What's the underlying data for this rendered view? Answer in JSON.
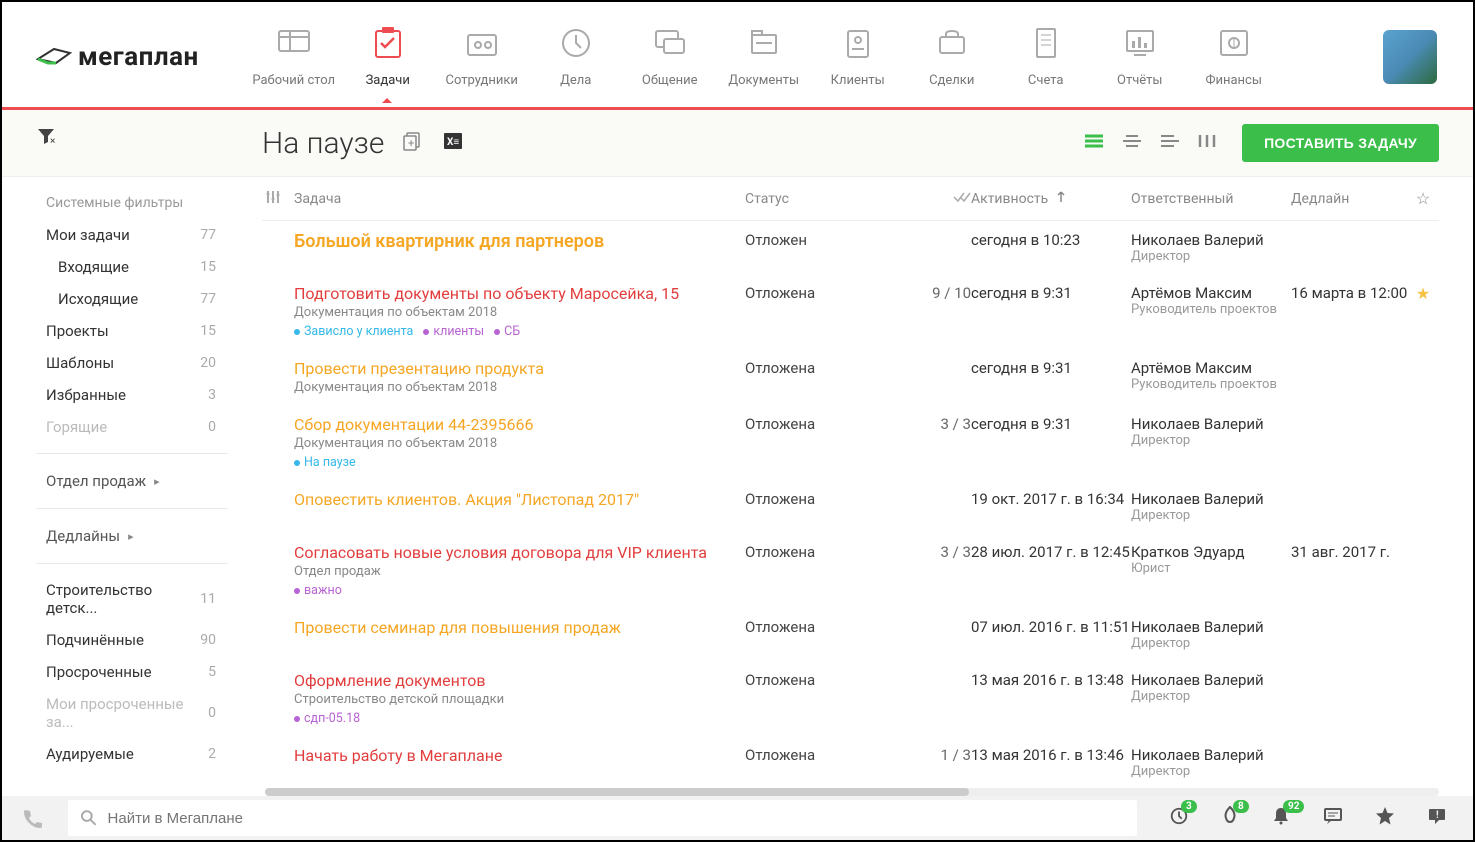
{
  "logo_text": "мегаплан",
  "nav": [
    {
      "label": "Рабочий стол",
      "icon": "desktop"
    },
    {
      "label": "Задачи",
      "icon": "tasks",
      "active": true
    },
    {
      "label": "Сотрудники",
      "icon": "staff"
    },
    {
      "label": "Дела",
      "icon": "time"
    },
    {
      "label": "Общение",
      "icon": "chat"
    },
    {
      "label": "Документы",
      "icon": "docs"
    },
    {
      "label": "Клиенты",
      "icon": "clients"
    },
    {
      "label": "Сделки",
      "icon": "deals"
    },
    {
      "label": "Счета",
      "icon": "invoices"
    },
    {
      "label": "Отчёты",
      "icon": "reports"
    },
    {
      "label": "Финансы",
      "icon": "finance"
    }
  ],
  "page": {
    "title": "На паузе",
    "primary_button": "ПОСТАВИТЬ ЗАДАЧУ"
  },
  "sidebar": {
    "filters_header": "Системные фильтры",
    "items": [
      {
        "label": "Мои задачи",
        "cnt": "77"
      },
      {
        "label": "Входящие",
        "cnt": "15",
        "sub": true
      },
      {
        "label": "Исходящие",
        "cnt": "77",
        "sub": true
      },
      {
        "label": "Проекты",
        "cnt": "15"
      },
      {
        "label": "Шаблоны",
        "cnt": "20"
      },
      {
        "label": "Избранные",
        "cnt": "3"
      },
      {
        "label": "Горящие",
        "cnt": "0",
        "muted": true
      }
    ],
    "group2": [
      {
        "label": "Отдел продаж",
        "arrow": true
      }
    ],
    "group3": [
      {
        "label": "Дедлайны",
        "arrow": true
      }
    ],
    "items2": [
      {
        "label": "Строительство детск...",
        "cnt": "11"
      },
      {
        "label": "Подчинённые",
        "cnt": "90"
      },
      {
        "label": "Просроченные",
        "cnt": "5"
      },
      {
        "label": "Мои просроченные за...",
        "cnt": "0",
        "muted": true
      },
      {
        "label": "Аудируемые",
        "cnt": "2"
      }
    ]
  },
  "table": {
    "headers": {
      "task": "Задача",
      "status": "Статус",
      "activity": "Активность",
      "responsible": "Ответственный",
      "deadline": "Дедлайн"
    },
    "rows": [
      {
        "title": "Большой квартирник для партнеров",
        "title_class": "t-orangeBold",
        "subtitle": "",
        "tags": [],
        "status": "Отложен",
        "check": "",
        "activity": "сегодня в 10:23",
        "resp": "Николаев Валерий",
        "role": "Директор",
        "deadline": "",
        "star": false
      },
      {
        "title": "Подготовить документы по объекту Маросейка, 15",
        "title_class": "t-red",
        "subtitle": "Документация по объектам 2018",
        "tags": [
          {
            "txt": "Зависло у клиента",
            "c": "#35b8e8"
          },
          {
            "txt": "клиенты",
            "c": "#b763d1"
          },
          {
            "txt": "СБ",
            "c": "#b763d1"
          }
        ],
        "status": "Отложена",
        "check": "9 / 10",
        "activity": "сегодня в 9:31",
        "resp": "Артёмов Максим",
        "role": "Руководитель проектов",
        "deadline": "16 марта в 12:00",
        "star": true
      },
      {
        "title": "Провести презентацию продукта",
        "title_class": "t-orange",
        "subtitle": "Документация по объектам 2018",
        "tags": [],
        "status": "Отложена",
        "check": "",
        "activity": "сегодня в 9:31",
        "resp": "Артёмов Максим",
        "role": "Руководитель проектов",
        "deadline": "",
        "star": false
      },
      {
        "title": "Сбор документации 44-2395666",
        "title_class": "t-orange",
        "subtitle": "Документация по объектам 2018",
        "tags": [
          {
            "txt": "На паузе",
            "c": "#35b8e8"
          }
        ],
        "status": "Отложена",
        "check": "3 / 3",
        "activity": "сегодня в 9:31",
        "resp": "Николаев Валерий",
        "role": "Директор",
        "deadline": "",
        "star": false
      },
      {
        "title": "Оповестить клиентов. Акция \"Листопад 2017\"",
        "title_class": "t-orange",
        "subtitle": "",
        "tags": [],
        "status": "Отложена",
        "check": "",
        "activity": "19 окт. 2017 г. в 16:34",
        "resp": "Николаев Валерий",
        "role": "Директор",
        "deadline": "",
        "star": false
      },
      {
        "title": "Согласовать новые условия договора для VIP клиента",
        "title_class": "t-red",
        "subtitle": "Отдел продаж",
        "tags": [
          {
            "txt": "важно",
            "c": "#b763d1"
          }
        ],
        "status": "Отложена",
        "check": "3 / 3",
        "activity": "28 июл. 2017 г. в 12:45",
        "resp": "Кратков Эдуард",
        "role": "Юрист",
        "deadline": "31 авг. 2017 г.",
        "star": false
      },
      {
        "title": "Провести семинар для повышения продаж",
        "title_class": "t-orange",
        "subtitle": "",
        "tags": [],
        "status": "Отложена",
        "check": "",
        "activity": "07 июл. 2016 г. в 11:51",
        "resp": "Николаев Валерий",
        "role": "Директор",
        "deadline": "",
        "star": false
      },
      {
        "title": "Оформление документов",
        "title_class": "t-red",
        "subtitle": "Строительство детской площадки",
        "tags": [
          {
            "txt": "сдп-05.18",
            "c": "#b763d1"
          }
        ],
        "status": "Отложена",
        "check": "",
        "activity": "13 мая 2016 г. в 13:48",
        "resp": "Николаев Валерий",
        "role": "Директор",
        "deadline": "",
        "star": false
      },
      {
        "title": "Начать работу в Мегаплане",
        "title_class": "t-red",
        "subtitle": "",
        "tags": [],
        "status": "Отложена",
        "check": "1 / 3",
        "activity": "13 мая 2016 г. в 13:46",
        "resp": "Николаев Валерий",
        "role": "Директор",
        "deadline": "",
        "star": false
      }
    ]
  },
  "bottombar": {
    "search_placeholder": "Найти в Мегаплане",
    "badges": {
      "clock": "3",
      "fire": "8",
      "bell": "92"
    }
  }
}
